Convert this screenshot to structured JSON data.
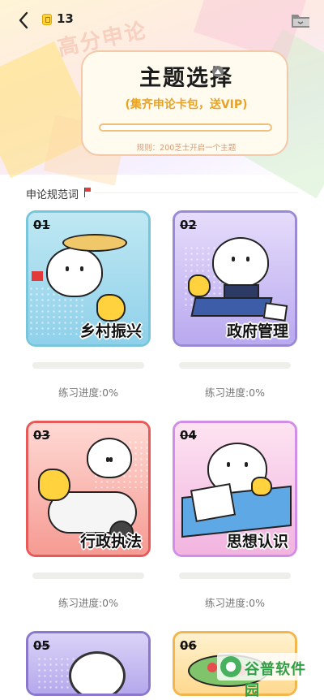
{
  "topbar": {
    "coin_count": "13",
    "back_icon": "chevron-left-icon",
    "coin_icon": "coin-icon",
    "folder_icon": "folder-icon"
  },
  "hero": {
    "watermark": "高分申论",
    "title": "主题选择",
    "subtitle": "(集齐申论卡包，送VIP)",
    "collection_progress": 0,
    "rule": "规则：200芝士开启一个主题"
  },
  "section": {
    "title": "申论规范词"
  },
  "cards": [
    {
      "num": "01",
      "label": "乡村振兴",
      "progress_text": "练习进度:0%",
      "progress": 0
    },
    {
      "num": "02",
      "label": "政府管理",
      "progress_text": "练习进度:0%",
      "progress": 0
    },
    {
      "num": "03",
      "label": "行政执法",
      "progress_text": "练习进度:0%",
      "progress": 0
    },
    {
      "num": "04",
      "label": "思想认识",
      "progress_text": "练习进度:0%",
      "progress": 0
    },
    {
      "num": "05"
    },
    {
      "num": "06"
    }
  ],
  "site_watermark": "谷普软件园",
  "colors": {
    "accent_orange": "#f3a33a",
    "subtitle_orange": "#e9a223",
    "card1_border": "#78c6dc",
    "card2_border": "#9a8ad6",
    "card3_border": "#e85a5a",
    "card4_border": "#d28ee6",
    "card5_border": "#8a78cc",
    "card6_border": "#f2b64c"
  }
}
